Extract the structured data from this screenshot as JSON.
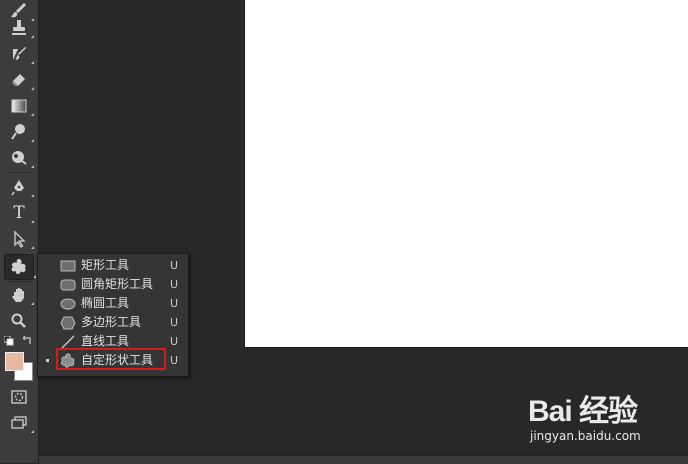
{
  "toolbar": {
    "tools": [
      {
        "name": "brush-tool",
        "icon": "brush-icon"
      },
      {
        "name": "clone-stamp-tool",
        "icon": "stamp-icon"
      },
      {
        "name": "history-brush-tool",
        "icon": "history-brush-icon"
      },
      {
        "name": "eraser-tool",
        "icon": "eraser-icon"
      },
      {
        "name": "gradient-tool",
        "icon": "gradient-icon"
      },
      {
        "name": "blur-tool",
        "icon": "blur-icon"
      },
      {
        "name": "dodge-tool",
        "icon": "dodge-icon"
      },
      {
        "name": "pen-tool",
        "icon": "pen-icon"
      },
      {
        "name": "type-tool",
        "icon": "type-icon",
        "glyph": "T"
      },
      {
        "name": "path-selection-tool",
        "icon": "arrow-icon"
      },
      {
        "name": "custom-shape-tool",
        "icon": "shape-icon",
        "active": true
      },
      {
        "name": "hand-tool",
        "icon": "hand-icon"
      },
      {
        "name": "zoom-tool",
        "icon": "zoom-icon"
      },
      {
        "name": "quick-mask-tool",
        "icon": "quick-mask-icon"
      },
      {
        "name": "screen-mode-tool",
        "icon": "screen-mode-icon"
      }
    ],
    "foreground_color": "#e8b9a1",
    "background_color": "#ffffff"
  },
  "flyout": {
    "items": [
      {
        "label": "矩形工具",
        "shortcut": "U",
        "icon": "rectangle-icon",
        "selected": false
      },
      {
        "label": "圆角矩形工具",
        "shortcut": "U",
        "icon": "rounded-rectangle-icon",
        "selected": false
      },
      {
        "label": "椭圆工具",
        "shortcut": "U",
        "icon": "ellipse-icon",
        "selected": false
      },
      {
        "label": "多边形工具",
        "shortcut": "U",
        "icon": "polygon-icon",
        "selected": false
      },
      {
        "label": "直线工具",
        "shortcut": "U",
        "icon": "line-icon",
        "selected": false
      },
      {
        "label": "自定形状工具",
        "shortcut": "U",
        "icon": "custom-shape-icon",
        "selected": true
      }
    ],
    "highlight_color": "#d01e1e"
  },
  "watermark": {
    "logo": "Bai 经验",
    "url": "jingyan.baidu.com"
  },
  "colors": {
    "workspace": "#282828",
    "toolbar": "#3c3c3c",
    "canvas": "#ffffff"
  }
}
